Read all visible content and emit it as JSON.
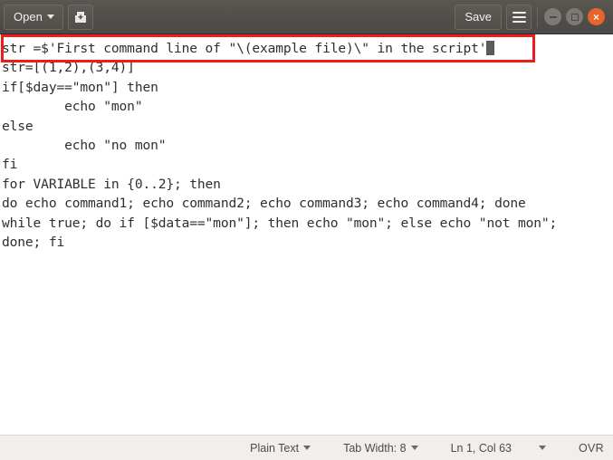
{
  "window": {
    "title": "",
    "app": "gedit"
  },
  "titlebar": {
    "open_label": "Open",
    "open_caret_icon": "chevron-down-icon",
    "new_document_icon": "save-as-document-icon",
    "save_label": "Save",
    "menu_icon": "hamburger-menu-icon",
    "minimize_icon": "window-minimize-icon",
    "maximize_icon": "window-maximize-icon",
    "close_icon": "window-close-icon",
    "close_glyph": "×"
  },
  "editor": {
    "cursor_visible": true,
    "lines": [
      "str =$'First command line of \"\\(example file)\\\" in the script'",
      "str=[(1,2),(3,4)]",
      "if[$day==\"mon\"] then",
      "        echo \"mon\"",
      "else",
      "        echo \"no mon\"",
      "fi",
      "for VARIABLE in {0..2}; then",
      "do echo command1; echo command2; echo command3; echo command4; done",
      "while true; do if [$data==\"mon\"]; then echo \"mon\"; else echo \"not mon\";",
      "done; fi"
    ],
    "annotation": {
      "type": "rectangle",
      "color": "#ee1c1c",
      "targets_line": 1
    }
  },
  "statusbar": {
    "language_label": "Plain Text",
    "language_caret_icon": "chevron-down-icon",
    "tab_width_label": "Tab Width: 8",
    "tab_width_caret_icon": "chevron-down-icon",
    "position_label": "Ln 1, Col 63",
    "position_caret_icon": "chevron-down-icon",
    "insert_mode_label": "OVR"
  },
  "colors": {
    "titlebar_bg": "#514e4a",
    "editor_bg": "#ffffff",
    "text": "#2f2f2f",
    "statusbar_bg": "#f1efee",
    "accent_close": "#e8642a",
    "annotation": "#ee1c1c",
    "cursor": "#5b5b5b"
  }
}
